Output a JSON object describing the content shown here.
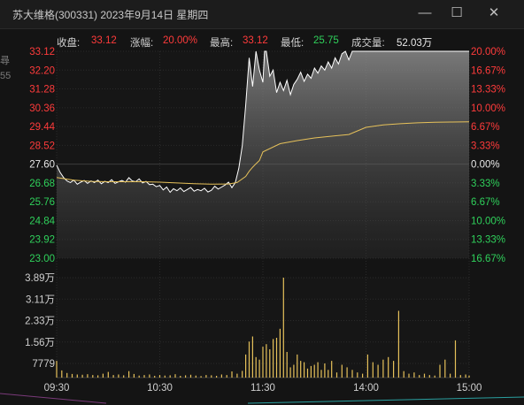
{
  "window": {
    "title": "苏大维格(300331)  2023年9月14日  星期四",
    "min_glyph": "—",
    "max_glyph": "☐",
    "close_glyph": "✕"
  },
  "info": {
    "close_label": "收盘:",
    "close_value": "33.12",
    "change_label": "涨幅:",
    "change_value": "20.00%",
    "high_label": "最高:",
    "high_value": "33.12",
    "low_label": "最低:",
    "low_value": "25.75",
    "volume_label": "成交量:",
    "volume_value": "52.03万"
  },
  "colors": {
    "up": "#ff3b3b",
    "down": "#2fd15b",
    "neutral": "#e8e8e8",
    "price_line": "#ffffff",
    "avg_line": "#e6c15a",
    "volume_bar": "#e6c15a"
  },
  "edge_fragments": [
    "尋",
    "55"
  ],
  "chart_data": {
    "type": "line",
    "title": "",
    "prev_close": 27.6,
    "price_ylim": [
      23.0,
      33.12
    ],
    "price_ticks": [
      "33.12",
      "32.20",
      "31.28",
      "30.36",
      "29.44",
      "28.52",
      "27.60",
      "26.68",
      "25.76",
      "24.84",
      "23.92",
      "23.00"
    ],
    "pct_ticks": [
      "20.00%",
      "16.67%",
      "13.33%",
      "10.00%",
      "6.67%",
      "3.33%",
      "0.00%",
      "3.33%",
      "6.67%",
      "10.00%",
      "13.33%",
      "16.67%"
    ],
    "volume_ticks": [
      "3.89万",
      "3.11万",
      "2.33万",
      "1.56万",
      "7779"
    ],
    "volume_ylim": [
      0,
      38900
    ],
    "x_ticks": [
      "09:30",
      "10:30",
      "11:30",
      "14:00",
      "15:00"
    ],
    "series": [
      {
        "name": "",
        "minutes": [
          0,
          2,
          4,
          6,
          8,
          10,
          12,
          14,
          16,
          18,
          20,
          22,
          24,
          26,
          28,
          30,
          32,
          34,
          36,
          38,
          40,
          42,
          44,
          46,
          48,
          50,
          52,
          54,
          56,
          58,
          60,
          62,
          64,
          66,
          68,
          70,
          72,
          74,
          76,
          78,
          80,
          82,
          84,
          86,
          88,
          90,
          92,
          94,
          96,
          98,
          100,
          102,
          104,
          106,
          108,
          110,
          112,
          114,
          116,
          118,
          120,
          121,
          122,
          124,
          126,
          128,
          130,
          132,
          134,
          136,
          138,
          140,
          142,
          144,
          146,
          148,
          150,
          152,
          154,
          156,
          158,
          160,
          162,
          164,
          166,
          168,
          170,
          172,
          174,
          176,
          178,
          180,
          182,
          184,
          186,
          188,
          190,
          192,
          194,
          196,
          198,
          200,
          202,
          204,
          206,
          208,
          210,
          212,
          214,
          216,
          218,
          220,
          222,
          224,
          226,
          228,
          230,
          232,
          234,
          236,
          238,
          240
        ],
        "values": [
          27.55,
          27.2,
          26.95,
          26.78,
          26.7,
          26.82,
          26.62,
          26.72,
          26.8,
          26.66,
          26.78,
          26.7,
          26.82,
          26.64,
          26.76,
          26.7,
          26.84,
          26.66,
          26.74,
          26.8,
          26.72,
          26.94,
          26.78,
          26.74,
          26.88,
          26.68,
          26.76,
          26.6,
          26.62,
          26.5,
          26.56,
          26.34,
          26.48,
          26.22,
          26.4,
          26.3,
          26.44,
          26.26,
          26.36,
          26.46,
          26.28,
          26.36,
          26.3,
          26.42,
          26.24,
          26.32,
          26.52,
          26.38,
          26.48,
          26.58,
          26.72,
          26.45,
          26.7,
          27.4,
          28.5,
          30.5,
          32.8,
          31.4,
          33.12,
          32.2,
          31.6,
          33.12,
          33.12,
          31.9,
          32.2,
          31.1,
          31.6,
          31.2,
          31.7,
          31.0,
          31.5,
          31.75,
          32.1,
          31.65,
          32.0,
          31.8,
          32.3,
          32.05,
          32.4,
          32.2,
          32.6,
          32.3,
          32.8,
          32.5,
          33.0,
          33.12,
          32.7,
          33.12,
          33.12,
          33.12,
          33.12,
          33.12,
          33.12,
          33.12,
          33.12,
          33.12,
          33.12,
          33.12,
          33.12,
          33.12,
          33.12,
          33.12,
          33.12,
          33.12,
          33.12,
          33.12,
          33.12,
          33.12,
          33.12,
          33.12,
          33.12,
          33.12,
          33.12,
          33.12,
          33.12,
          33.12,
          33.12,
          33.12,
          33.12,
          33.12,
          33.12,
          33.12
        ]
      },
      {
        "name": "",
        "minutes": [
          0,
          10,
          20,
          30,
          40,
          50,
          60,
          70,
          80,
          90,
          100,
          105,
          110,
          112,
          114,
          116,
          118,
          120,
          130,
          140,
          150,
          160,
          170,
          180,
          190,
          200,
          210,
          220,
          230,
          240
        ],
        "values": [
          26.95,
          26.82,
          26.76,
          26.74,
          26.74,
          26.74,
          26.72,
          26.68,
          26.64,
          26.62,
          26.63,
          26.7,
          27.0,
          27.25,
          27.45,
          27.62,
          27.78,
          28.2,
          28.6,
          28.75,
          28.88,
          28.97,
          29.05,
          29.4,
          29.52,
          29.58,
          29.62,
          29.65,
          29.66,
          29.67
        ]
      }
    ],
    "volume": {
      "minutes": [
        0,
        3,
        6,
        9,
        12,
        15,
        18,
        21,
        24,
        27,
        30,
        33,
        36,
        39,
        42,
        45,
        48,
        51,
        54,
        57,
        60,
        63,
        66,
        69,
        72,
        75,
        78,
        81,
        84,
        87,
        90,
        93,
        96,
        99,
        102,
        105,
        108,
        110,
        112,
        114,
        116,
        118,
        120,
        122,
        124,
        126,
        128,
        130,
        132,
        134,
        136,
        138,
        140,
        142,
        144,
        146,
        148,
        150,
        152,
        154,
        156,
        158,
        160,
        163,
        166,
        169,
        172,
        175,
        178,
        181,
        184,
        187,
        190,
        193,
        196,
        199,
        202,
        205,
        208,
        211,
        214,
        217,
        220,
        223,
        226,
        229,
        232,
        235,
        238,
        240
      ],
      "values": [
        6500,
        2800,
        1800,
        1400,
        1200,
        1100,
        1300,
        1000,
        900,
        1500,
        2200,
        1000,
        1200,
        900,
        2500,
        1400,
        800,
        1000,
        1200,
        700,
        1000,
        800,
        900,
        1300,
        700,
        900,
        1100,
        800,
        600,
        1000,
        900,
        700,
        1200,
        1000,
        2400,
        1500,
        2600,
        9000,
        14000,
        16000,
        8000,
        7000,
        12000,
        13000,
        11000,
        15000,
        15500,
        19000,
        38900,
        10000,
        4000,
        5000,
        9000,
        6500,
        6000,
        3500,
        4500,
        5000,
        6000,
        3000,
        5500,
        3000,
        6500,
        2000,
        5000,
        4000,
        3000,
        2000,
        1500,
        9000,
        6000,
        5000,
        7000,
        8000,
        6500,
        26000,
        2500,
        1500,
        2000,
        1000,
        1500,
        1000,
        800,
        5000,
        7000,
        1500,
        14500,
        1000,
        1200,
        800,
        700,
        900,
        1100,
        5000
      ]
    }
  }
}
